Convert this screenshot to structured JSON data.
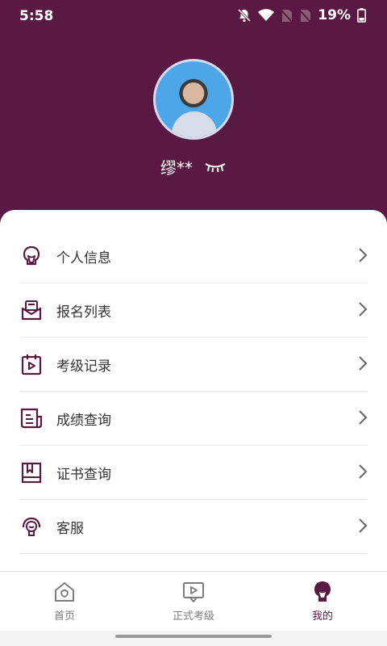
{
  "statusbar": {
    "time": "5:58",
    "battery": "19%"
  },
  "profile": {
    "username": "缪**"
  },
  "menu": {
    "items": [
      {
        "label": "个人信息",
        "icon": "person-icon"
      },
      {
        "label": "报名列表",
        "icon": "envelope-icon"
      },
      {
        "label": "考级记录",
        "icon": "calendar-play-icon"
      },
      {
        "label": "成绩查询",
        "icon": "document-icon"
      },
      {
        "label": "证书查询",
        "icon": "book-icon"
      },
      {
        "label": "客服",
        "icon": "headset-icon"
      }
    ]
  },
  "tabbar": {
    "tabs": [
      {
        "label": "首页",
        "icon": "home-icon",
        "active": false
      },
      {
        "label": "正式考级",
        "icon": "play-screen-icon",
        "active": false
      },
      {
        "label": "我的",
        "icon": "person-icon",
        "active": true
      }
    ]
  },
  "colors": {
    "brand": "#5a1942",
    "header_bg": "#5a1942",
    "text": "#333333",
    "inactive_tab": "#7b7b7b"
  }
}
